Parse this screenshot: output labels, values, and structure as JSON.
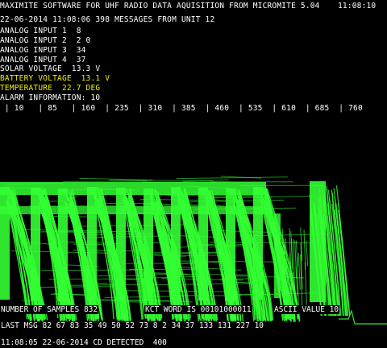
{
  "header": {
    "title": "MAXIMITE SOFTWARE FOR UHF RADIO DATA AQUISITION FROM MICROMITE 5.04",
    "clock": "11:08:10",
    "message_line": "22-06-2014 11:08:06 398 MESSAGES FROM UNIT 12"
  },
  "readings": {
    "analog1": "ANALOG INPUT 1  8",
    "analog2": "ANALOG INPUT 2  2 0",
    "analog3": "ANALOG INPUT 3  34",
    "analog4": "ANALOG INPUT 4  37",
    "solar": "SOLAR VOLTAGE  13.3 V",
    "battery": "BATTERY VOLTAGE  13.1 V",
    "temperature": "TEMPERATURE  22.7 DEG",
    "alarm": "ALARM INFORMATION: 10"
  },
  "scale": {
    "ticks": " | 10   | 85   | 160  | 235  | 310  | 385  | 460  | 535  | 610  | 685  | 760"
  },
  "status": {
    "samples": "NUMBER OF SAMPLES 832",
    "kct": "KCT WORD IS 00101000011",
    "ascii": "ASCII VALUE 10",
    "last_msg": "LAST MSG 82 67 83 35 49 50 52 73 8 2 34 37 133 131 227 10",
    "detected": "11:08:05 22-06-2014 CD DETECTED  400"
  },
  "colors": {
    "background": "#000000",
    "text": "#ffffff",
    "highlight": "#f2f000",
    "trace": "#33ff33"
  }
}
